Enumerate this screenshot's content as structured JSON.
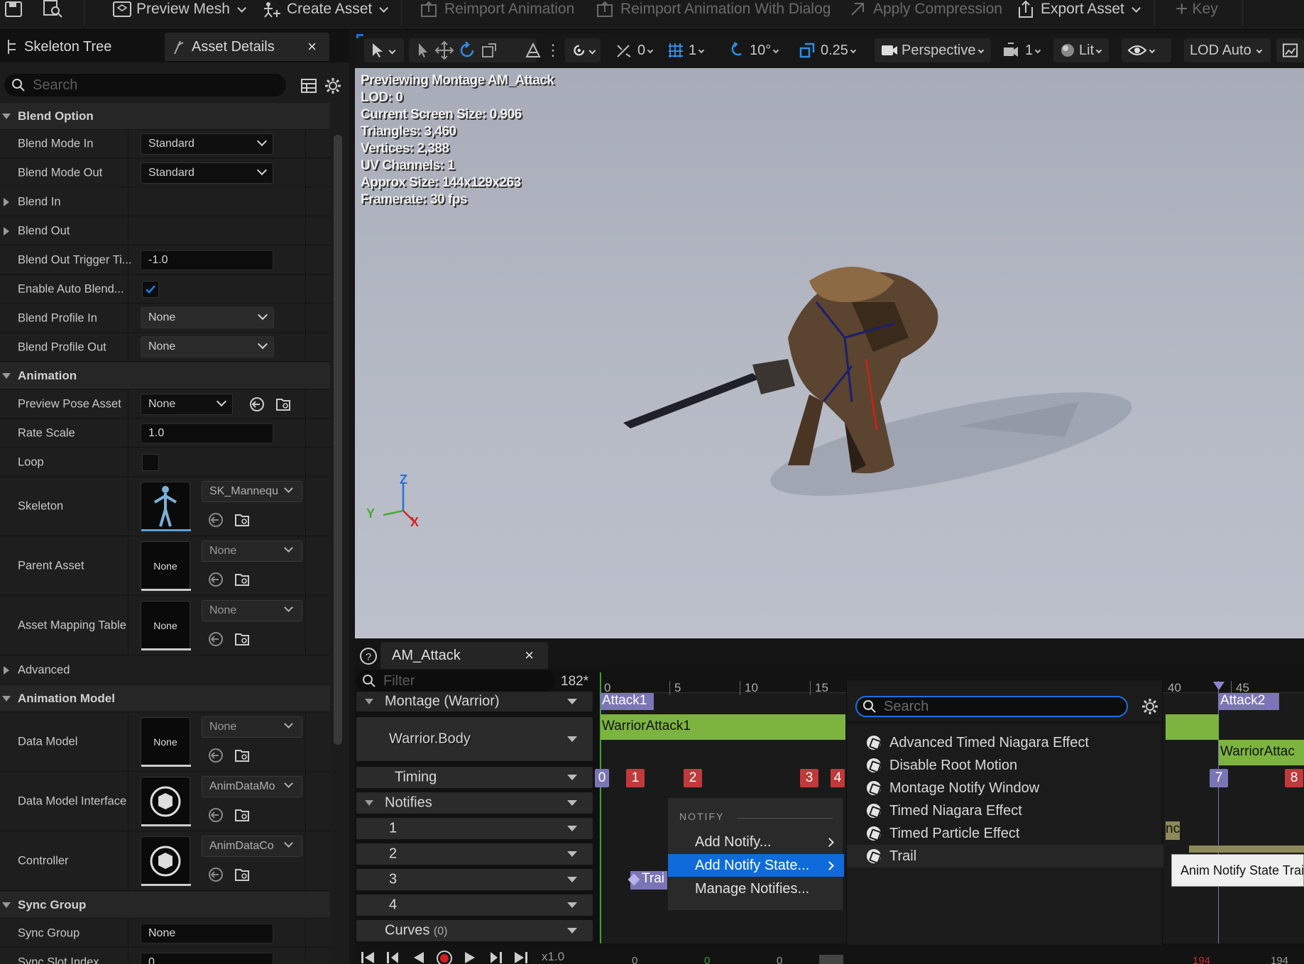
{
  "toolbar": {
    "preview_mesh": "Preview Mesh",
    "create_asset": "Create Asset",
    "reimport_animation": "Reimport Animation",
    "reimport_with_dialog": "Reimport Animation With Dialog",
    "apply_compression": "Apply Compression",
    "export_asset": "Export Asset",
    "key": "Key"
  },
  "left_tabs": {
    "skeleton_tree": "Skeleton Tree",
    "asset_details": "Asset Details",
    "close": "×"
  },
  "search": {
    "placeholder": "Search"
  },
  "details": {
    "blend_option": "Blend Option",
    "blend_mode_in": "Blend Mode In",
    "blend_mode_in_value": "Standard",
    "blend_mode_out": "Blend Mode Out",
    "blend_mode_out_value": "Standard",
    "blend_in": "Blend In",
    "blend_out": "Blend Out",
    "blend_out_trigger": "Blend Out Trigger Ti...",
    "blend_out_trigger_value": "-1.0",
    "enable_auto_blend": "Enable Auto Blend...",
    "blend_profile_in": "Blend Profile In",
    "blend_profile_in_value": "None",
    "blend_profile_out": "Blend Profile Out",
    "blend_profile_out_value": "None",
    "animation": "Animation",
    "preview_pose_asset": "Preview Pose Asset",
    "preview_pose_asset_value": "None",
    "rate_scale": "Rate Scale",
    "rate_scale_value": "1.0",
    "loop": "Loop",
    "skeleton": "Skeleton",
    "skeleton_value": "SK_Mannequ",
    "parent_asset": "Parent Asset",
    "parent_asset_thumb": "None",
    "parent_asset_value": "None",
    "asset_mapping_table": "Asset Mapping Table",
    "asset_mapping_thumb": "None",
    "asset_mapping_value": "None",
    "advanced": "Advanced",
    "animation_model": "Animation Model",
    "data_model": "Data Model",
    "data_model_thumb": "None",
    "data_model_value": "None",
    "data_model_interface": "Data Model Interface",
    "data_model_interface_value": "AnimDataMo",
    "controller": "Controller",
    "controller_value": "AnimDataCo",
    "sync_group_section": "Sync Group",
    "sync_group": "Sync Group",
    "sync_group_value": "None",
    "sync_slot_index": "Sync Slot Index",
    "sync_slot_index_value": "0"
  },
  "viewport_toolbar": {
    "snap_translate": "0",
    "grid": "1",
    "rotation": "10°",
    "scale": "0.25",
    "perspective": "Perspective",
    "camera_speed": "1",
    "lit": "Lit",
    "lod": "LOD Auto"
  },
  "viewport_stats": [
    "Previewing Montage AM_Attack",
    "LOD: 0",
    "Current Screen Size: 0.906",
    "Triangles: 3,460",
    "Vertices: 2,388",
    "UV Channels: 1",
    "Approx Size: 144x129x263",
    "Framerate: 30 fps"
  ],
  "axes": {
    "z": "Z",
    "y": "Y",
    "x": "X"
  },
  "montage": {
    "tab": "AM_Attack",
    "close": "×",
    "filter_placeholder": "Filter",
    "frame_count": "182*",
    "tracks": {
      "montage": "Montage (Warrior)",
      "slot": "Warrior.Body",
      "timing": "Timing",
      "notifies": "Notifies",
      "n1": "1",
      "n2": "2",
      "n3": "3",
      "n4": "4",
      "curves": "Curves",
      "curves_count": "(0)"
    },
    "ruler": [
      "0",
      "5",
      "10",
      "15",
      "40",
      "45"
    ],
    "sections": {
      "attack1": "Attack1",
      "attack2": "Attack2"
    },
    "segments": {
      "warrior_attack1": "WarriorAttack1",
      "warrior_attack_right": "WarriorAttac"
    },
    "timing_markers": [
      "0",
      "1",
      "2",
      "3",
      "4",
      "7",
      "8"
    ],
    "notify_partial_trail": "Trai",
    "notify_partial_nc": "nc",
    "playback_rate": "x1.0",
    "bottom_numbers": [
      "0",
      "0",
      "0",
      "194",
      "194"
    ]
  },
  "context_menu": {
    "header": "NOTIFY",
    "add_notify": "Add Notify...",
    "add_notify_state": "Add Notify State...",
    "manage_notifies": "Manage Notifies..."
  },
  "submenu": {
    "search_placeholder": "Search",
    "items": [
      "Advanced Timed Niagara Effect",
      "Disable Root Motion",
      "Montage Notify Window",
      "Timed Niagara Effect",
      "Timed Particle Effect",
      "Trail"
    ]
  },
  "tooltip": "Anim Notify State Trai",
  "colors": {
    "accent_blue": "#1a6fe0",
    "montage_green": "#7db43f",
    "section_purple": "#7a76b6",
    "timing_red": "#c0393b",
    "menu_highlight": "#0f6bd9"
  }
}
